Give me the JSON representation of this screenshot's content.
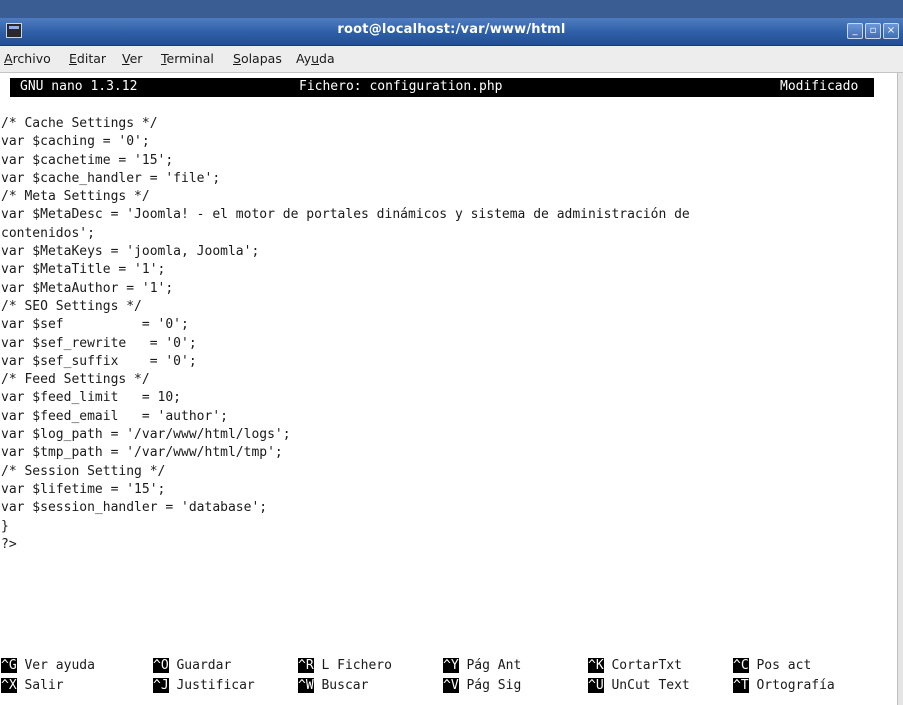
{
  "window": {
    "title": "root@localhost:/var/www/html",
    "buttons": [
      "minimize",
      "maximize",
      "close"
    ]
  },
  "menubar": {
    "items": [
      {
        "label": "Archivo",
        "access": "A"
      },
      {
        "label": "Editar",
        "access": "E"
      },
      {
        "label": "Ver",
        "access": "V"
      },
      {
        "label": "Terminal",
        "access": "T"
      },
      {
        "label": "Solapas",
        "access": "S"
      },
      {
        "label": "Ayuda",
        "access": "u"
      }
    ]
  },
  "nano": {
    "version": "GNU nano 1.3.12",
    "file": "Fichero: configuration.php",
    "status": "Modificado"
  },
  "code_lines": [
    "/* Cache Settings */",
    "var $caching = '0';",
    "var $cachetime = '15';",
    "var $cache_handler = 'file';",
    "/* Meta Settings */",
    "var $MetaDesc = 'Joomla! - el motor de portales dinámicos y sistema de administración de",
    "contenidos';",
    "var $MetaKeys = 'joomla, Joomla';",
    "var $MetaTitle = '1';",
    "var $MetaAuthor = '1';",
    "/* SEO Settings */",
    "var $sef          = '0';",
    "var $sef_rewrite   = '0';",
    "var $sef_suffix    = '0';",
    "/* Feed Settings */",
    "var $feed_limit   = 10;",
    "var $feed_email   = 'author';",
    "var $log_path = '/var/www/html/logs';",
    "var $tmp_path = '/var/www/html/tmp';",
    "/* Session Setting */",
    "var $lifetime = '15';",
    "var $session_handler = 'database';",
    "}",
    "?>"
  ],
  "shortcuts": [
    [
      {
        "key": "^G",
        "label": "Ver ayuda"
      },
      {
        "key": "^O",
        "label": "Guardar"
      },
      {
        "key": "^R",
        "label": "L Fichero"
      },
      {
        "key": "^Y",
        "label": "Pág Ant"
      },
      {
        "key": "^K",
        "label": "CortarTxt"
      },
      {
        "key": "^C",
        "label": "Pos act"
      }
    ],
    [
      {
        "key": "^X",
        "label": "Salir"
      },
      {
        "key": "^J",
        "label": "Justificar"
      },
      {
        "key": "^W",
        "label": "Buscar"
      },
      {
        "key": "^V",
        "label": "Pág Sig"
      },
      {
        "key": "^U",
        "label": "UnCut Text"
      },
      {
        "key": "^T",
        "label": "Ortografía"
      }
    ]
  ],
  "colors": {
    "titlebar": "#2d5ea6",
    "terminal_bg": "#ffffff",
    "terminal_fg": "#1a1a1a",
    "inverse_bg": "#000000"
  }
}
